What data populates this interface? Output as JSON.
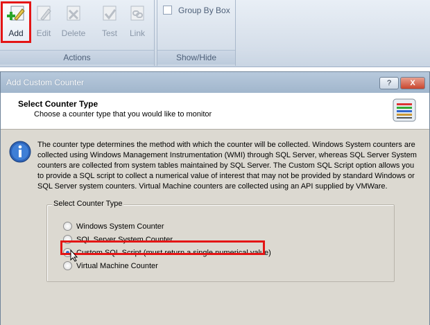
{
  "ribbon": {
    "buttons": [
      {
        "label": "Add",
        "icon": "add-counter-icon",
        "enabled": true
      },
      {
        "label": "Edit",
        "icon": "edit-icon",
        "enabled": false
      },
      {
        "label": "Delete",
        "icon": "delete-icon",
        "enabled": false
      },
      {
        "label": "Test",
        "icon": "test-icon",
        "enabled": false
      },
      {
        "label": "Link",
        "icon": "link-icon",
        "enabled": false
      }
    ],
    "actions_group_label": "Actions",
    "group_by_box_label": "Group By Box",
    "group_by_box_checked": false,
    "showhide_group_label": "Show/Hide"
  },
  "dialog": {
    "title": "Add Custom Counter",
    "help_button": "?",
    "close_button": "X",
    "header_title": "Select Counter Type",
    "header_subtitle": "Choose a counter type that you would like to monitor",
    "description": "The counter type determines the method with which the counter will be collected. Windows System counters are collected using Windows Management Instrumentation (WMI) through SQL Server, whereas SQL Server System counters are collected from system tables maintained by SQL Server. The Custom SQL Script option allows you to provide a SQL script to collect a numerical value of interest that may not be provided by standard Windows or SQL Server system counters.  Virtual Machine counters are collected using an API supplied by VMWare.",
    "group_label": "Select Counter Type",
    "options": [
      {
        "label": "Windows System Counter",
        "selected": false
      },
      {
        "label": "SQL Server System Counter",
        "selected": false
      },
      {
        "label": "Custom SQL Script (must return a single numerical value)",
        "selected": true
      },
      {
        "label": "Virtual Machine Counter",
        "selected": false
      }
    ]
  },
  "colors": {
    "highlight": "#e41515",
    "accent": "#2f6fc8"
  }
}
